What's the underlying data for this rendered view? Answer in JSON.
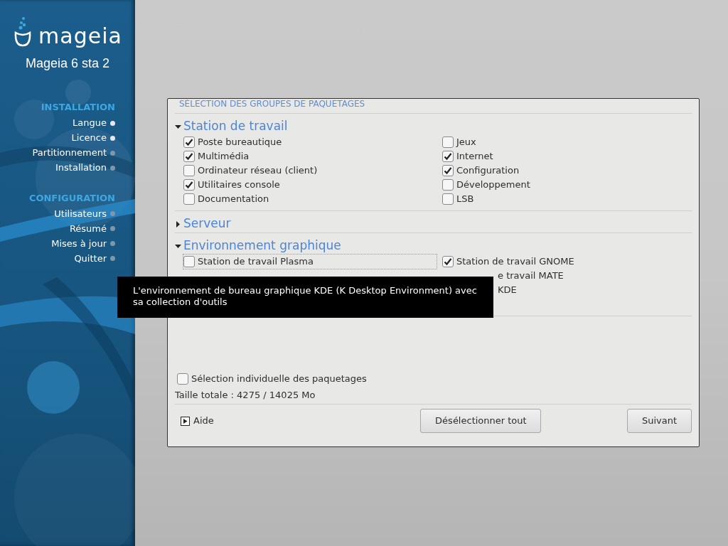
{
  "sidebar": {
    "logo_text": "mageia",
    "version": "Mageia 6 sta 2",
    "sections": [
      {
        "title": "INSTALLATION",
        "steps": [
          {
            "label": "Langue",
            "done": true
          },
          {
            "label": "Licence",
            "done": true
          },
          {
            "label": "Partitionnement",
            "done": false
          },
          {
            "label": "Installation",
            "done": false
          }
        ]
      },
      {
        "title": "CONFIGURATION",
        "steps": [
          {
            "label": "Utilisateurs",
            "done": false
          },
          {
            "label": "Résumé",
            "done": false
          },
          {
            "label": "Mises à jour",
            "done": false
          },
          {
            "label": "Quitter",
            "done": false
          }
        ]
      }
    ]
  },
  "dialog": {
    "title": "SÉLECTION DES GROUPES DE PAQUETAGES",
    "groups": [
      {
        "title": "Station de travail",
        "expanded": true,
        "items": [
          {
            "kind": "checkbox",
            "label": "Poste bureautique",
            "checked": true
          },
          {
            "kind": "checkbox",
            "label": "Jeux",
            "checked": false
          },
          {
            "kind": "checkbox",
            "label": "Multimédia",
            "checked": true
          },
          {
            "kind": "checkbox",
            "label": "Internet",
            "checked": true
          },
          {
            "kind": "checkbox",
            "label": "Ordinateur réseau (client)",
            "checked": false
          },
          {
            "kind": "checkbox",
            "label": "Configuration",
            "checked": true
          },
          {
            "kind": "checkbox",
            "label": "Utilitaires console",
            "checked": true
          },
          {
            "kind": "checkbox",
            "label": "Développement",
            "checked": false
          },
          {
            "kind": "checkbox",
            "label": "Documentation",
            "checked": false
          },
          {
            "kind": "checkbox",
            "label": "LSB",
            "checked": false
          }
        ]
      },
      {
        "title": "Serveur",
        "expanded": false
      },
      {
        "title": "Environnement graphique",
        "expanded": true,
        "items": [
          {
            "kind": "checkbox",
            "label": "Station de travail Plasma",
            "checked": false,
            "focused": true
          },
          {
            "kind": "checkbox",
            "label": "Station de travail GNOME",
            "checked": true
          },
          {
            "kind": "hidden"
          },
          {
            "kind": "partial",
            "label": "e travail MATE"
          },
          {
            "kind": "hidden"
          },
          {
            "kind": "partial",
            "label": "KDE"
          },
          {
            "kind": "hidden"
          },
          {
            "kind": "hidden"
          }
        ]
      }
    ],
    "tooltip": "L'environnement de bureau graphique KDE (K Desktop Environment) avec sa collection d'outils",
    "individual": {
      "label": "Sélection individuelle des paquetages",
      "checked": false
    },
    "total": "Taille totale : 4275 / 14025 Mo",
    "help": "Aide",
    "deselect": "Désélectionner tout",
    "next": "Suivant"
  }
}
